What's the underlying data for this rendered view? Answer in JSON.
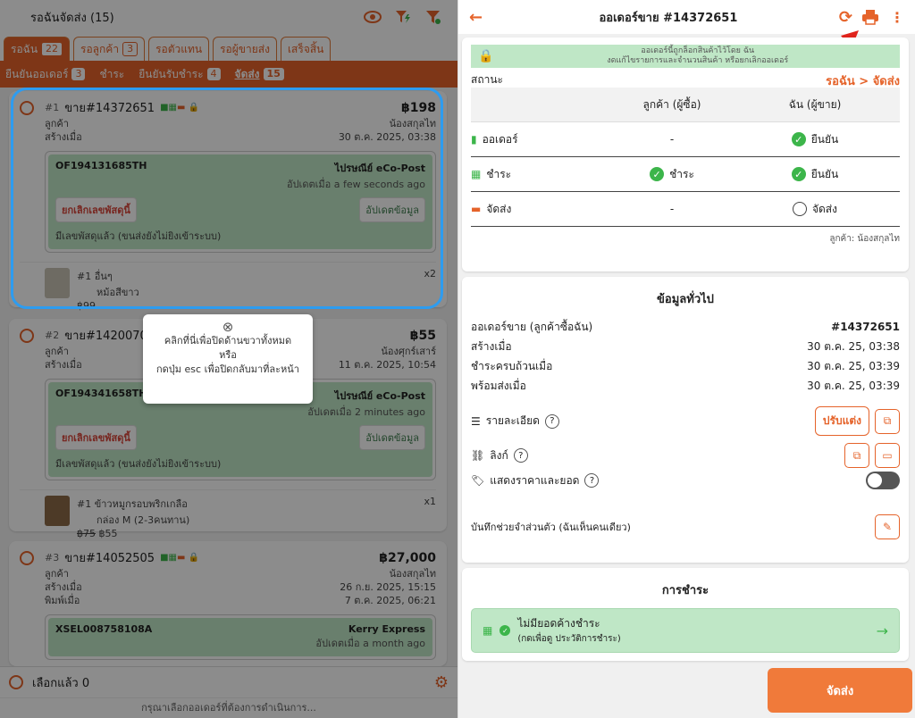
{
  "left": {
    "title": "รอฉันจัดส่ง (15)",
    "tabs": [
      {
        "label": "รอฉัน",
        "count": "22"
      },
      {
        "label": "รอลูกค้า",
        "count": "3"
      },
      {
        "label": "รอตัวแทน"
      },
      {
        "label": "รอผู้ขายส่ง"
      },
      {
        "label": "เสร็จสิ้น"
      }
    ],
    "subtabs": [
      {
        "label": "ยืนยันออเดอร์",
        "count": "3"
      },
      {
        "label": "ชำระ"
      },
      {
        "label": "ยืนยันรับชำระ",
        "count": "4"
      },
      {
        "label": "จัดส่ง",
        "count": "15"
      }
    ],
    "orders": [
      {
        "num": "#1",
        "id": "ขาย#14372651",
        "total": "฿198",
        "customer_label": "ลูกค้า",
        "customer": "น้องสกุลไท",
        "created_label": "สร้างเมื่อ",
        "created": "30 ต.ค. 2025, 03:38",
        "tracking": "OF194131685TH",
        "carrier": "ไปรษณีย์ eCo-Post",
        "updated": "อัปเดตเมื่อ a few seconds ago",
        "cancel_btn": "ยกเลิกเลขพัสดุนี้",
        "update_btn": "อัปเดตข้อมูล",
        "note": "มีเลขพัสดุแล้ว (ขนส่งยังไม่ยิงเข้าระบบ)",
        "item_num": "#1",
        "item_name": "อื่นๆ",
        "item_sub": "หม้อสีขาว",
        "item_price": "฿99",
        "item_qty": "x2"
      },
      {
        "num": "#2",
        "id": "ขาย#14200702",
        "total": "฿55",
        "customer_label": "ลูกค้า",
        "customer": "น้องศุกร์เสาร์",
        "created_label": "สร้างเมื่อ",
        "created": "11 ต.ค. 2025, 10:54",
        "tracking": "OF194341658TH",
        "carrier": "ไปรษณีย์ eCo-Post",
        "updated": "อัปเดตเมื่อ 2 minutes ago",
        "cancel_btn": "ยกเลิกเลขพัสดุนี้",
        "update_btn": "อัปเดตข้อมูล",
        "note": "มีเลขพัสดุแล้ว (ขนส่งยังไม่ยิงเข้าระบบ)",
        "item_num": "#1",
        "item_name": "ข้าวหมูกรอบพริกเกลือ",
        "item_sub": "กล่อง M (2-3คนทาน)",
        "item_old_price": "฿75",
        "item_price": "฿55",
        "item_qty": "x1"
      },
      {
        "num": "#3",
        "id": "ขาย#14052505",
        "total": "฿27,000",
        "customer_label": "ลูกค้า",
        "customer": "น้องสกุลไท",
        "created_label": "สร้างเมื่อ",
        "created": "26 ก.ย. 2025, 15:15",
        "printed_label": "พิมพ์เมื่อ",
        "printed": "7 ต.ค. 2025, 06:21",
        "tracking": "XSEL008758108A",
        "carrier": "Kerry Express",
        "updated": "อัปเดตเมื่อ a month ago"
      }
    ],
    "selected": "เลือกแล้ว 0",
    "footer_hint": "กรุณาเลือกออเดอร์ที่ต้องการดำเนินการ...",
    "tooltip": {
      "line1": "คลิกที่นี่เพื่อปิดด้านขวาทั้งหมด",
      "line2": "หรือ",
      "line3": "กดปุ่ม esc เพื่อปิดกลับมาที่ละหน้า"
    }
  },
  "right": {
    "title": "ออเดอร์ขาย #14372651",
    "lock_line1": "ออเดอร์นี้ถูกล็อกสินค้าไว้โดย ฉัน",
    "lock_line2": "งดแก้ไขรายการและจำนวนสินค้า หรือยกเลิกออเดอร์",
    "status_label": "สถานะ",
    "status_value": "รอฉัน > จัดส่ง",
    "col_customer": "ลูกค้า (ผู้ซื้อ)",
    "col_me": "ฉัน (ผู้ขาย)",
    "rows": [
      {
        "label": "ออเดอร์",
        "customer": "-",
        "me": "ยืนยัน"
      },
      {
        "label": "ชำระ",
        "customer": "ชำระ",
        "me": "ยืนยัน"
      },
      {
        "label": "จัดส่ง",
        "customer": "-",
        "me": "จัดส่ง"
      }
    ],
    "customer_note": "ลูกค้า: น้องสกุลไท",
    "general_title": "ข้อมูลทั่วไป",
    "general": [
      {
        "k": "ออเดอร์ขาย (ลูกค้าซื้อฉัน)",
        "v": "#14372651"
      },
      {
        "k": "สร้างเมื่อ",
        "v": "30 ต.ค. 25, 03:38"
      },
      {
        "k": "ชำระครบถ้วนเมื่อ",
        "v": "30 ต.ค. 25, 03:39"
      },
      {
        "k": "พร้อมส่งเมื่อ",
        "v": "30 ต.ค. 25, 03:39"
      }
    ],
    "detail_label": "รายละเอียด",
    "edit_btn": "ปรับแต่ง",
    "link_label": "ลิงก์",
    "price_label": "แสดงราคาและยอด",
    "private_note": "บันทึกช่วยจำส่วนตัว (ฉันเห็นคนเดียว)",
    "payment_title": "การชำระ",
    "payment_line1": "ไม่มียอดค้างชำระ",
    "payment_line2": "(กดเพื่อดู ประวัติการชำระ)",
    "ship_btn": "จัดส่ง",
    "accent": "#e5632a"
  }
}
